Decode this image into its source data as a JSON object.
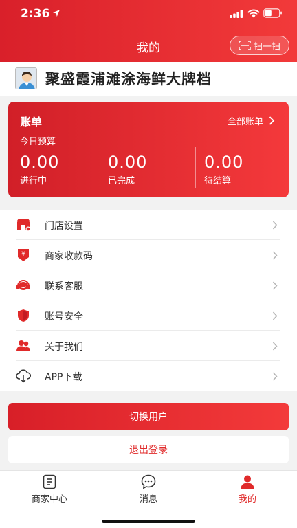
{
  "status_bar": {
    "time": "2:36"
  },
  "header": {
    "title": "我的",
    "scan_label": "扫一扫"
  },
  "shop": {
    "name": "聚盛霞浦滩涂海鲜大牌档"
  },
  "bill": {
    "title": "账单",
    "all_label": "全部账单",
    "today_label": "今日预算",
    "stats": [
      {
        "value": "0.00",
        "label": "进行中"
      },
      {
        "value": "0.00",
        "label": "已完成"
      },
      {
        "value": "0.00",
        "label": "待结算"
      }
    ]
  },
  "menu": {
    "items": [
      {
        "label": "门店设置",
        "icon": "store-icon"
      },
      {
        "label": "商家收款码",
        "icon": "payment-code-icon"
      },
      {
        "label": "联系客服",
        "icon": "headset-icon"
      },
      {
        "label": "账号安全",
        "icon": "shield-icon"
      },
      {
        "label": "关于我们",
        "icon": "users-icon"
      },
      {
        "label": "APP下载",
        "icon": "cloud-download-icon"
      }
    ]
  },
  "actions": {
    "switch_user": "切换用户",
    "logout": "退出登录"
  },
  "tabbar": {
    "tabs": [
      {
        "label": "商家中心",
        "icon": "merchant-center-icon"
      },
      {
        "label": "消息",
        "icon": "message-icon"
      },
      {
        "label": "我的",
        "icon": "profile-icon",
        "active": true
      }
    ]
  },
  "colors": {
    "brand_red": "#e02a2a",
    "gradient_start": "#d9202a",
    "gradient_end": "#f23a3a"
  }
}
